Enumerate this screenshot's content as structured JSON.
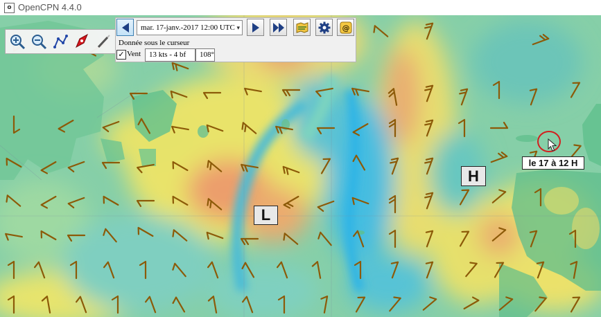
{
  "window": {
    "title": "OpenCPN 4.4.0",
    "app_icon": "opencpn-app-icon"
  },
  "toolbar": {
    "buttons": [
      {
        "name": "zoom-in-button",
        "icon": "zoom-in-icon"
      },
      {
        "name": "zoom-out-button",
        "icon": "zoom-out-icon"
      },
      {
        "name": "route-button",
        "icon": "route-icon"
      },
      {
        "name": "boat-button",
        "icon": "boat-icon"
      },
      {
        "name": "tools-button",
        "icon": "tools-icon"
      }
    ]
  },
  "grib": {
    "datetime": "mar. 17-janv.-2017 12:00  UTC",
    "cursor_title": "Donnée sous le curseur",
    "wind_checkbox_checked": true,
    "wind_label": "Vent",
    "wind_speed": "13 kts - 4 bf",
    "wind_direction": "108°",
    "buttons": [
      "prev-icon",
      "next-icon",
      "play-icon",
      "grib-chart-icon",
      "settings-icon",
      "request-icon"
    ]
  },
  "map": {
    "pressure_labels": [
      {
        "name": "low-pressure-label",
        "text": "L"
      },
      {
        "name": "high-pressure-label",
        "text": "H"
      }
    ],
    "annotation": "le 17 à 12 H",
    "colors": {
      "land": "#5dc08e",
      "low_wind": "#2fb7df",
      "medium_wind": "#e6e26a",
      "high_wind": "#e8a070",
      "arrow": "#8c5a08",
      "annotation_circle": "#d21f1f"
    }
  }
}
